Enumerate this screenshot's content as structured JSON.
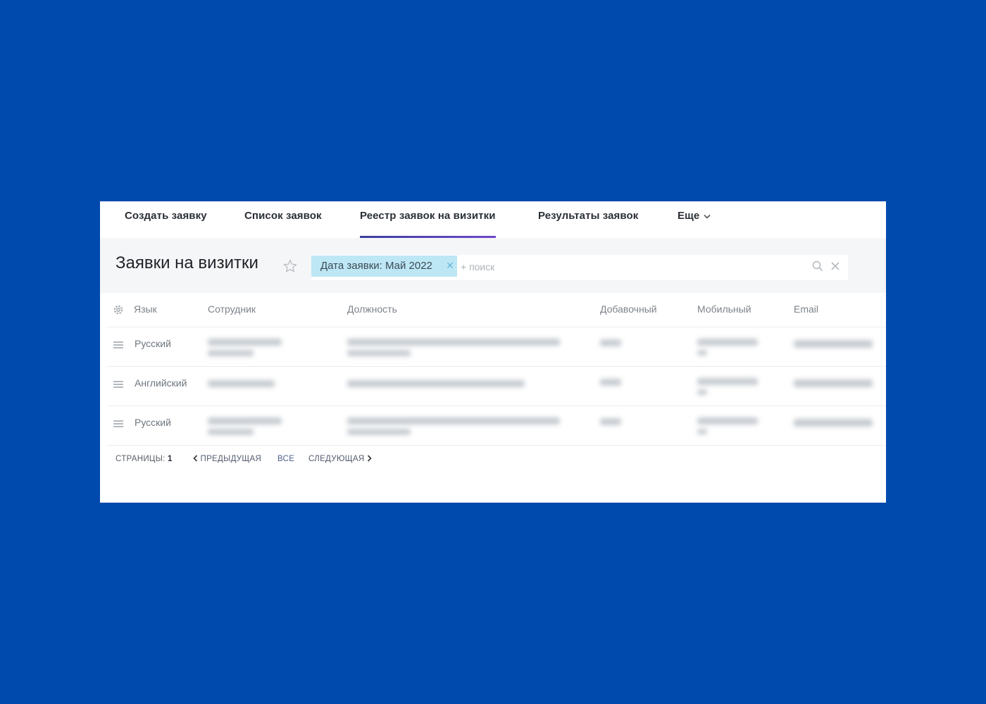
{
  "tabs": [
    {
      "label": "Создать заявку"
    },
    {
      "label": "Список заявок"
    },
    {
      "label": "Реестр заявок на визитки",
      "active": true
    },
    {
      "label": "Результаты заявок"
    },
    {
      "label": "Еще"
    }
  ],
  "page_title": "Заявки на визитки",
  "filter": {
    "chip_label": "Дата заявки: Май 2022",
    "placeholder": "+ поиск"
  },
  "table": {
    "columns": [
      "Язык",
      "Сотрудник",
      "Должность",
      "Добавочный",
      "Мобильный",
      "Email"
    ],
    "rows": [
      {
        "language": "Русский"
      },
      {
        "language": "Английский"
      },
      {
        "language": "Русский"
      }
    ]
  },
  "pagination": {
    "pages_label": "СТРАНИЦЫ:",
    "current_page": "1",
    "prev_label": "ПРЕДЫДУЩАЯ",
    "all_label": "ВСЕ",
    "next_label": "СЛЕДУЮЩАЯ"
  },
  "colors": {
    "background": "#004aad",
    "chip": "#bde7f5",
    "active_tab_underline": "#4b3fb0"
  }
}
